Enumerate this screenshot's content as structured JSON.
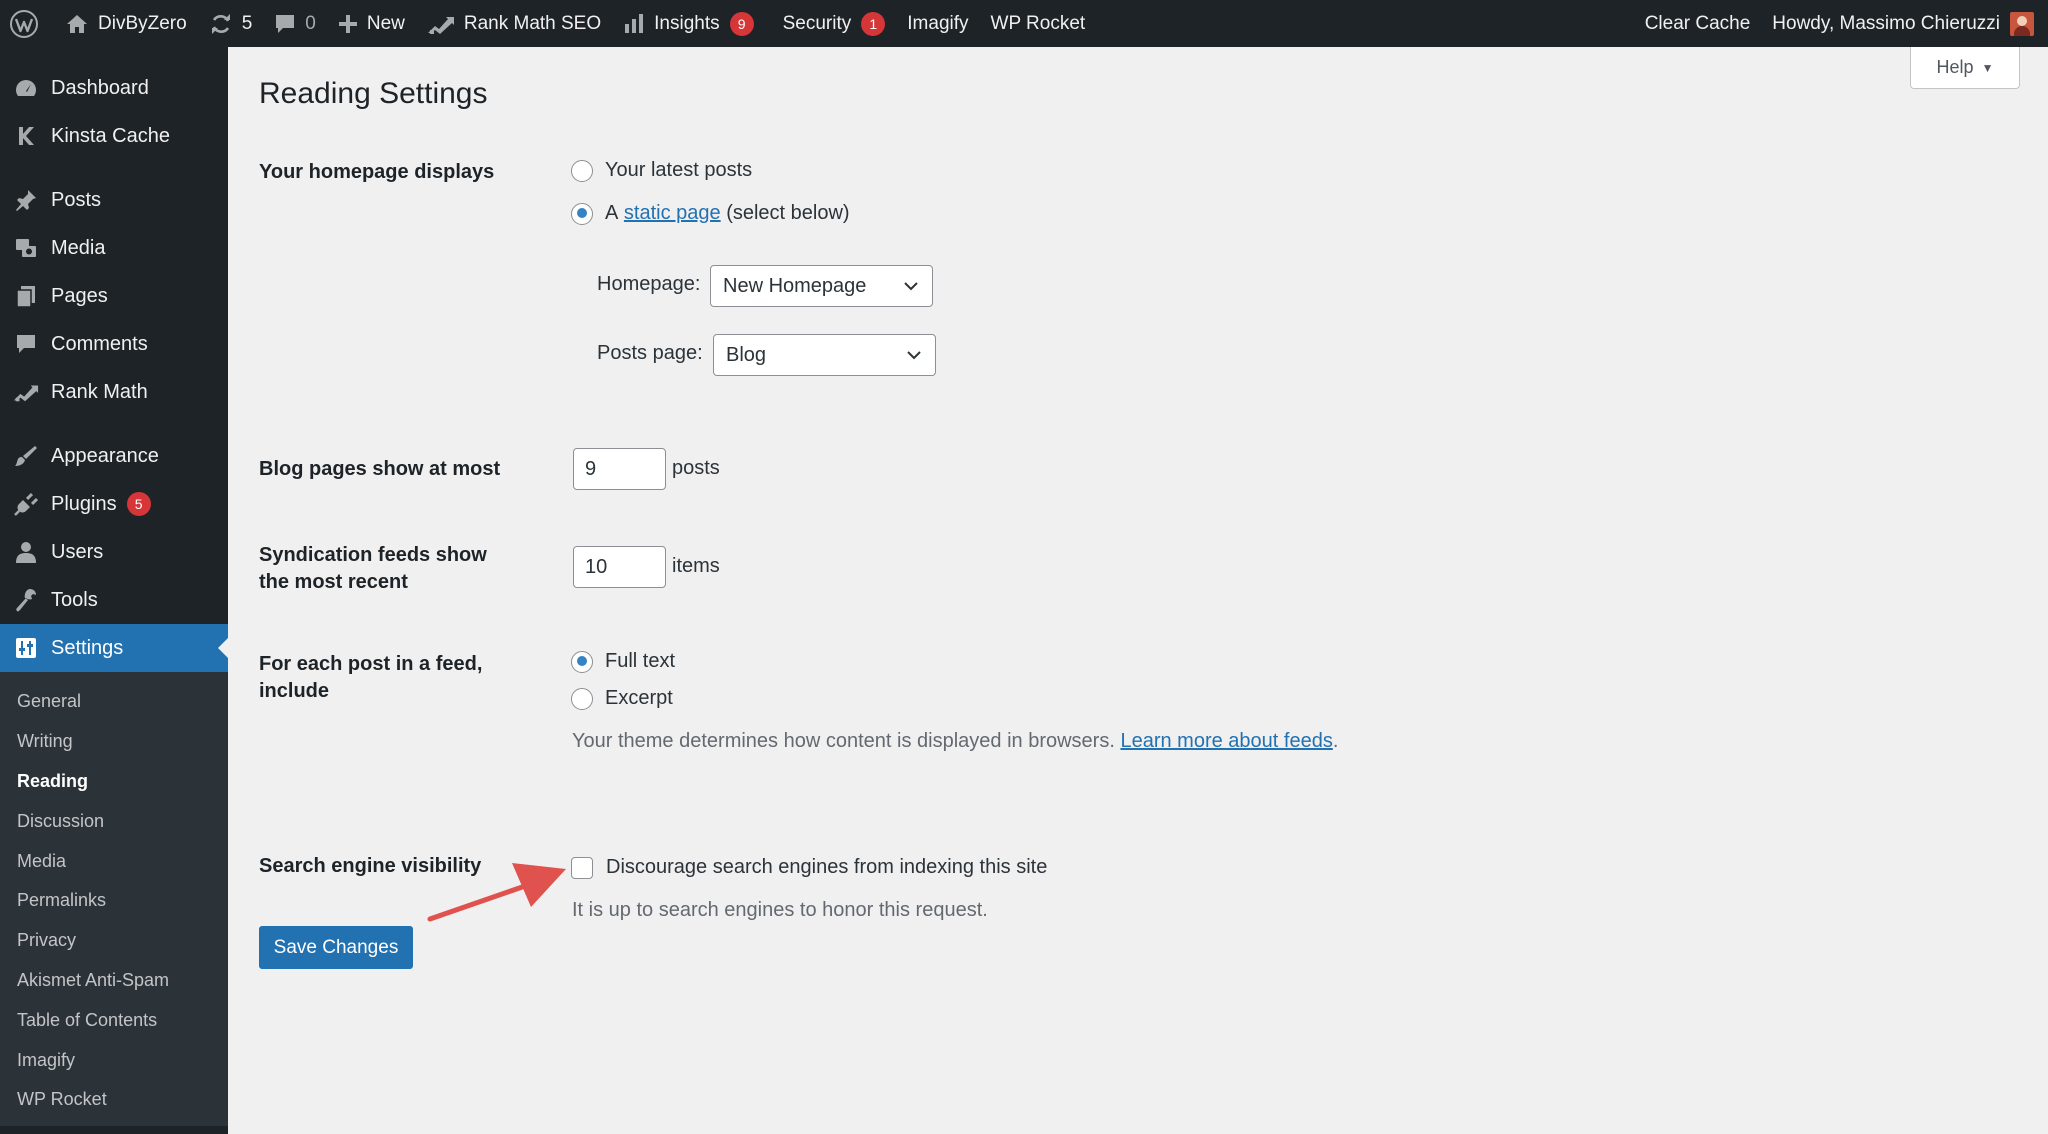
{
  "adminbar": {
    "site_name": "DivByZero",
    "updates_count": "5",
    "comments_count": "0",
    "new_label": "New",
    "rankmath_label": "Rank Math SEO",
    "insights_label": "Insights",
    "insights_badge": "9",
    "security_label": "Security",
    "security_badge": "1",
    "imagify_label": "Imagify",
    "wprocket_label": "WP Rocket",
    "clear_cache_label": "Clear Cache",
    "howdy_label": "Howdy, Massimo Chieruzzi"
  },
  "sidebar": {
    "dashboard": "Dashboard",
    "kinsta": "Kinsta Cache",
    "posts": "Posts",
    "media": "Media",
    "pages": "Pages",
    "comments": "Comments",
    "rankmath": "Rank Math",
    "appearance": "Appearance",
    "plugins": "Plugins",
    "plugins_badge": "5",
    "users": "Users",
    "tools": "Tools",
    "settings": "Settings",
    "submenu": [
      "General",
      "Writing",
      "Reading",
      "Discussion",
      "Media",
      "Permalinks",
      "Privacy",
      "Akismet Anti-Spam",
      "Table of Contents",
      "Imagify",
      "WP Rocket"
    ],
    "current_submenu": "Reading"
  },
  "help_label": "Help",
  "page_title": "Reading Settings",
  "homepage": {
    "label": "Your homepage displays",
    "option_latest": "Your latest posts",
    "option_static_prefix": "A",
    "option_static_link": "static page",
    "option_static_suffix": "(select below)",
    "selected": "static",
    "homepage_label": "Homepage:",
    "homepage_value": "New Homepage",
    "posts_page_label": "Posts page:",
    "posts_page_value": "Blog"
  },
  "blog_pages": {
    "label": "Blog pages show at most",
    "value": "9",
    "unit": "posts"
  },
  "syndication": {
    "label": "Syndication feeds show the most recent",
    "value": "10",
    "unit": "items"
  },
  "feed_include": {
    "label": "For each post in a feed, include",
    "option_full": "Full text",
    "option_excerpt": "Excerpt",
    "selected": "full",
    "desc_text": "Your theme determines how content is displayed in browsers.",
    "desc_link": "Learn more about feeds",
    "desc_end": "."
  },
  "search_visibility": {
    "label": "Search engine visibility",
    "checkbox_label": "Discourage search engines from indexing this site",
    "checked": false,
    "desc": "It is up to search engines to honor this request."
  },
  "save_label": "Save Changes",
  "colors": {
    "primary": "#2271b1",
    "admin_dark": "#1d2327",
    "badge": "#d63638",
    "annotation_arrow": "#e0524e"
  }
}
